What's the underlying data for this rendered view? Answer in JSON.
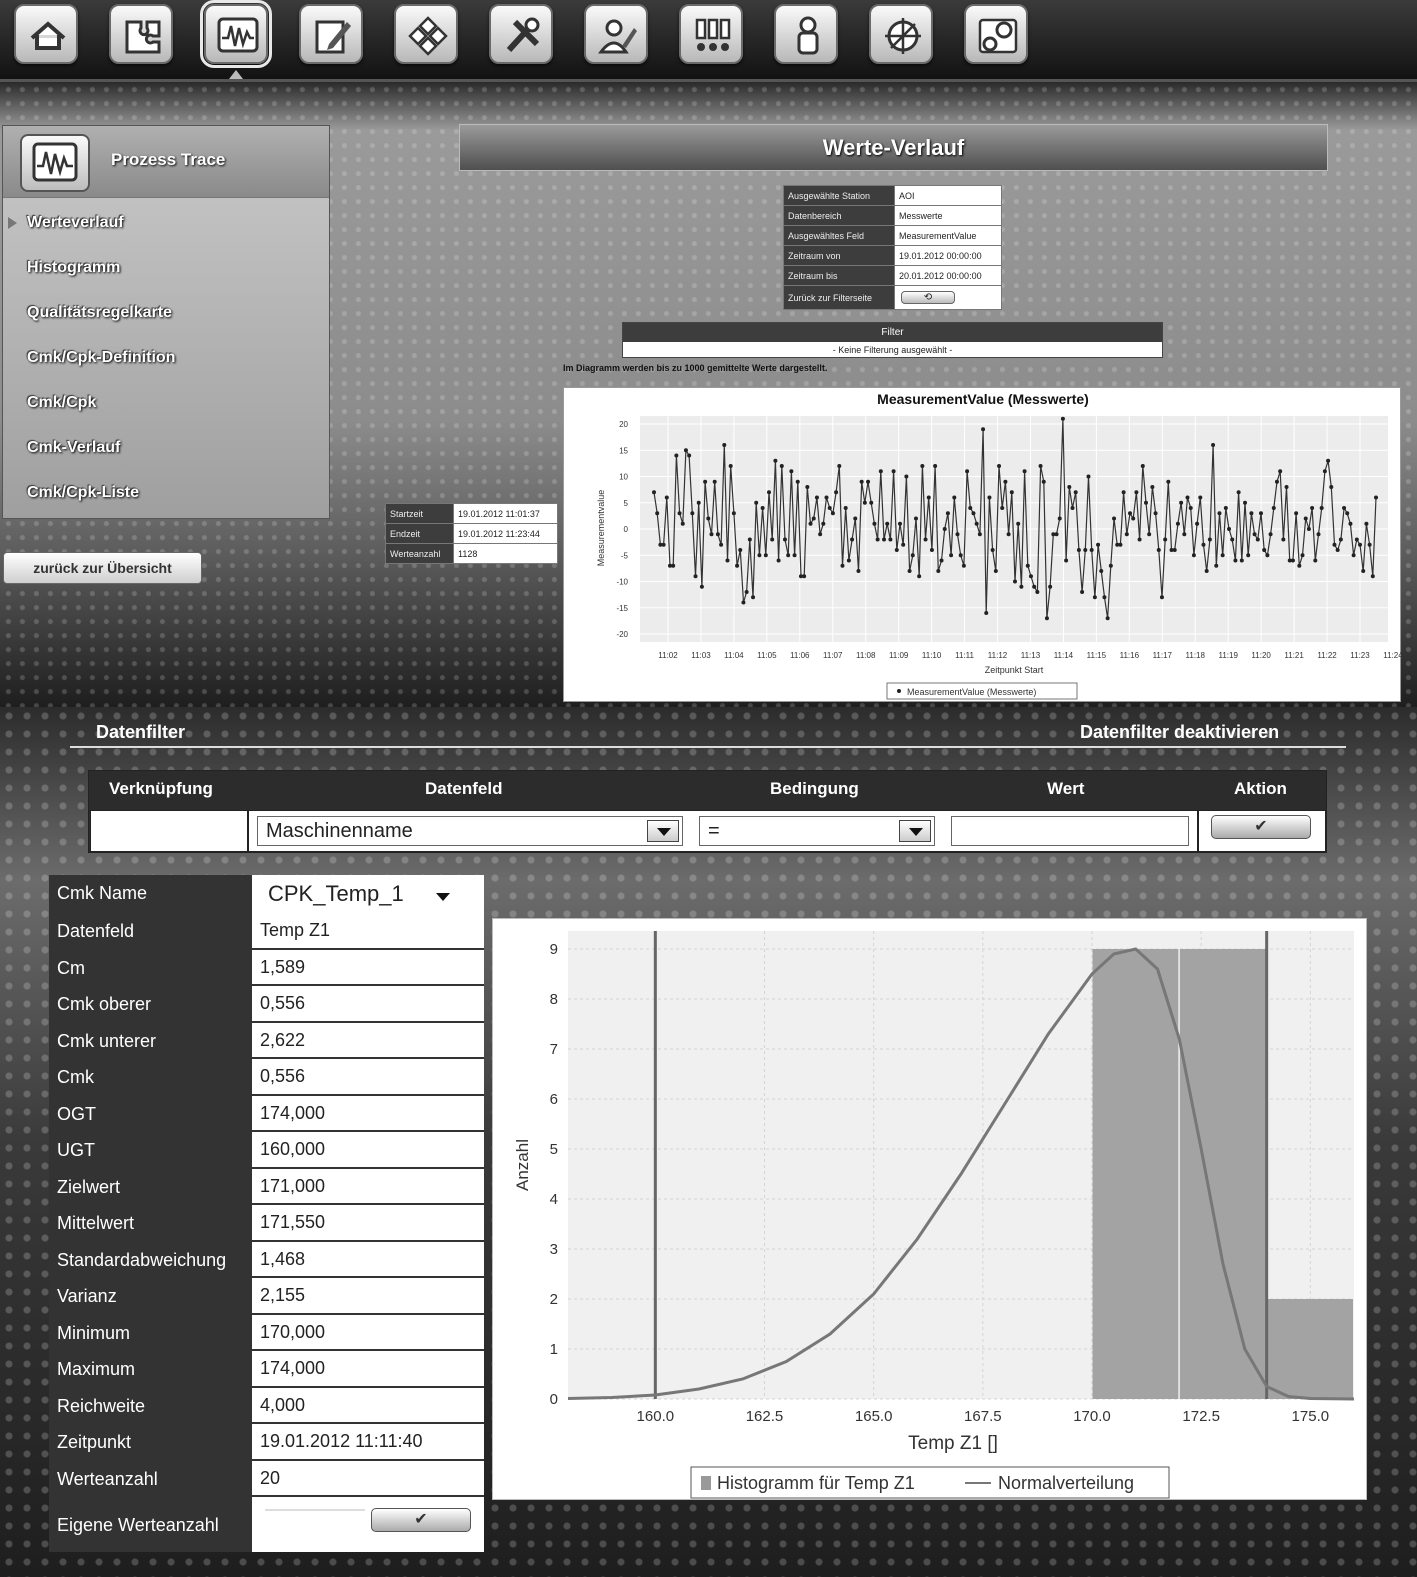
{
  "toolbar": {
    "icons": [
      "home-icon",
      "puzzle-icon",
      "process-trace-icon",
      "edit-icon",
      "modules-icon",
      "tools-icon",
      "user-edit-icon",
      "alerts-icon",
      "person-icon",
      "compass-icon",
      "settings-gear-icon"
    ],
    "active_index": 2
  },
  "side_menu": {
    "title": "Prozess Trace",
    "items": [
      "Werteverlauf",
      "Histogramm",
      "Qualitätsregelkarte",
      "Cmk/Cpk-Definition",
      "Cmk/Cpk",
      "Cmk-Verlauf",
      "Cmk/Cpk-Liste"
    ],
    "selected": "Werteverlauf",
    "back_label": "zurück zur Übersicht"
  },
  "page_title": "Werte-Verlauf",
  "selection_info": [
    {
      "label": "Ausgewählte Station",
      "value": "AOI"
    },
    {
      "label": "Datenbereich",
      "value": "Messwerte"
    },
    {
      "label": "Ausgewähltes Feld",
      "value": "MeasurementValue"
    },
    {
      "label": "Zeitraum von",
      "value": "19.01.2012 00:00:00"
    },
    {
      "label": "Zeitraum bis",
      "value": "20.01.2012 00:00:00"
    }
  ],
  "back_to_filter_label": "Zurück zur Filterseite",
  "filter": {
    "header": "Filter",
    "body": "- Keine Filterung ausgewählt -"
  },
  "diagram_note": "Im Diagramm werden bis zu 1000 gemittelte Werte dargestellt.",
  "trace_stats": [
    {
      "label": "Startzeit",
      "value": "19.01.2012 11:01:37"
    },
    {
      "label": "Endzeit",
      "value": "19.01.2012 11:23:44"
    },
    {
      "label": "Werteanzahl",
      "value": "1128"
    }
  ],
  "trace_chart": {
    "title": "MeasurementValue (Messwerte)",
    "ylabel": "Measurementvalue",
    "xlabel": "Zeitpunkt Start",
    "legend": "MeasurementValue (Messwerte)",
    "yticks": [
      "20",
      "15",
      "10",
      "5",
      "0",
      "-5",
      "-10",
      "-15",
      "-20"
    ],
    "xticks": [
      "11:02",
      "11:03",
      "11:04",
      "11:05",
      "11:06",
      "11:07",
      "11:08",
      "11:09",
      "11:10",
      "11:11",
      "11:12",
      "11:13",
      "11:14",
      "11:15",
      "11:16",
      "11:17",
      "11:18",
      "11:19",
      "11:20",
      "11:21",
      "11:22",
      "11:23",
      "11:24"
    ]
  },
  "datenfilter": {
    "title": "Datenfilter",
    "deactivate": "Datenfilter deaktivieren",
    "headers": [
      "Verknüpfung",
      "Datenfeld",
      "Bedingung",
      "Wert",
      "Aktion"
    ],
    "datenfeld_value": "Maschinenname",
    "bedingung_value": "=",
    "wert_value": "",
    "action_icon": "✔"
  },
  "cmk": {
    "name_label": "Cmk Name",
    "name_value": "CPK_Temp_1",
    "rows": [
      {
        "label": "Datenfeld",
        "value": "Temp Z1"
      },
      {
        "label": "Cm",
        "value": "1,589"
      },
      {
        "label": "Cmk oberer",
        "value": "0,556"
      },
      {
        "label": "Cmk unterer",
        "value": "2,622"
      },
      {
        "label": "Cmk",
        "value": "0,556"
      },
      {
        "label": "OGT",
        "value": "174,000"
      },
      {
        "label": "UGT",
        "value": "160,000"
      },
      {
        "label": "Zielwert",
        "value": "171,000"
      },
      {
        "label": "Mittelwert",
        "value": "171,550"
      },
      {
        "label": "Standardabweichung",
        "value": "1,468"
      },
      {
        "label": "Varianz",
        "value": "2,155"
      },
      {
        "label": "Minimum",
        "value": "170,000"
      },
      {
        "label": "Maximum",
        "value": "174,000"
      },
      {
        "label": "Reichweite",
        "value": "4,000"
      },
      {
        "label": "Zeitpunkt",
        "value": "19.01.2012 11:11:40"
      },
      {
        "label": "Werteanzahl",
        "value": "20"
      }
    ],
    "own_count_label": "Eigene Werteanzahl"
  },
  "chart_data": [
    {
      "type": "line",
      "title": "MeasurementValue (Messwerte)",
      "xlabel": "Zeitpunkt Start",
      "ylabel": "Measurementvalue",
      "ylim": [
        -20,
        20
      ],
      "xlim": [
        "11:01:37",
        "11:23:44"
      ],
      "grid": true,
      "legend": "bottom",
      "series": [
        {
          "name": "MeasurementValue (Messwerte)",
          "values": [
            7,
            3,
            -3,
            -3,
            6,
            -7,
            -7,
            14,
            3,
            1,
            15,
            14,
            3,
            -9,
            5,
            -11,
            9,
            2,
            -1,
            9,
            -1,
            -3,
            16,
            -6,
            12,
            3,
            -7,
            -4,
            -14,
            -12,
            -2,
            -13,
            5,
            -5,
            4,
            -5,
            7,
            -2,
            13,
            -6,
            12,
            -2,
            -5,
            11,
            -5,
            9,
            -9,
            -9,
            8,
            1,
            2,
            6,
            -1,
            1,
            6,
            4,
            3,
            7,
            12,
            -7,
            4,
            -6,
            -2,
            2,
            -8,
            9,
            5,
            9,
            5,
            1,
            -2,
            11,
            -2,
            1,
            -2,
            11,
            -4,
            1,
            -3,
            10,
            -8,
            -5,
            2,
            -9,
            12,
            -2,
            6,
            -4,
            12,
            -8,
            -6,
            0,
            3,
            -5,
            6,
            -1,
            -5,
            -7,
            11,
            4,
            3,
            1,
            -1,
            19,
            -16,
            6,
            -4,
            -8,
            12,
            4,
            9,
            -1,
            7,
            -10,
            1,
            -11,
            11,
            -7,
            -9,
            -11,
            -12,
            12,
            9,
            -17,
            -11,
            -1,
            -1,
            2,
            21,
            -6,
            8,
            4,
            7,
            -4,
            -12,
            -4,
            10,
            -4,
            -13,
            -3,
            -8,
            -13,
            -17,
            -7,
            2,
            -3,
            -3,
            7,
            -1,
            3,
            2,
            7,
            -2,
            12,
            5,
            -1,
            8,
            3,
            -4,
            -13,
            -2,
            9,
            -4,
            -4,
            1,
            5,
            -1,
            6,
            4,
            -5,
            1,
            6,
            -3,
            -8,
            -2,
            16,
            -7,
            3,
            -5,
            4,
            0,
            -2,
            -6,
            7,
            -6,
            5,
            -5,
            3,
            -1,
            -2,
            3,
            -4,
            -5,
            -1,
            4,
            9,
            11,
            -2,
            8,
            -6,
            -6,
            3,
            -7,
            -5,
            2,
            0,
            4,
            -6,
            -1,
            4,
            11,
            13,
            8,
            -3,
            -4,
            -2,
            4,
            3,
            1,
            -5,
            -2,
            -3,
            -8,
            1,
            -3,
            -9,
            6
          ]
        }
      ]
    },
    {
      "type": "bar",
      "title": "",
      "xlabel": "Temp Z1 []",
      "ylabel": "Anzahl",
      "xlim": [
        158.0,
        176.0
      ],
      "ylim": [
        0,
        9
      ],
      "xticks": [
        160.0,
        162.5,
        165.0,
        167.5,
        170.0,
        172.5,
        175.0
      ],
      "yticks": [
        0,
        1,
        2,
        3,
        4,
        5,
        6,
        7,
        8,
        9
      ],
      "legend": "bottom",
      "series": [
        {
          "name": "Histogramm für Temp Z1",
          "type": "bar",
          "bins": [
            {
              "from": 170.0,
              "to": 172.0,
              "count": 9
            },
            {
              "from": 172.0,
              "to": 174.0,
              "count": 9
            },
            {
              "from": 174.0,
              "to": 176.0,
              "count": 2
            }
          ]
        },
        {
          "name": "Normalverteilung",
          "type": "line",
          "x": [
            158,
            159,
            160,
            161,
            162,
            163,
            164,
            165,
            166,
            167,
            168,
            169,
            170,
            170.5,
            171,
            171.5,
            172,
            172.5,
            173,
            173.5,
            174,
            174.5,
            175,
            176
          ],
          "values": [
            0.01,
            0.03,
            0.08,
            0.2,
            0.4,
            0.75,
            1.3,
            2.1,
            3.2,
            4.5,
            5.9,
            7.3,
            8.5,
            8.9,
            9.0,
            8.6,
            7.2,
            5.0,
            2.7,
            1.0,
            0.25,
            0.05,
            0.01,
            0
          ]
        },
        {
          "name": "UGT",
          "type": "vline",
          "x": 160.0
        },
        {
          "name": "OGT",
          "type": "vline",
          "x": 174.0
        }
      ],
      "legend_labels": [
        "Histogramm für Temp Z1",
        "Normalverteilung"
      ]
    }
  ]
}
